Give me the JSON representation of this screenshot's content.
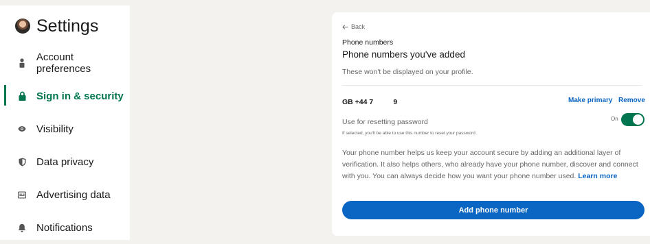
{
  "sidebar": {
    "title": "Settings",
    "items": [
      {
        "label": "Account preferences",
        "icon": "person-icon",
        "active": false
      },
      {
        "label": "Sign in & security",
        "icon": "lock-icon",
        "active": true
      },
      {
        "label": "Visibility",
        "icon": "eye-icon",
        "active": false
      },
      {
        "label": "Data privacy",
        "icon": "shield-icon",
        "active": false
      },
      {
        "label": "Advertising data",
        "icon": "ad-card-icon",
        "active": false
      },
      {
        "label": "Notifications",
        "icon": "bell-icon",
        "active": false
      }
    ]
  },
  "panel": {
    "back_label": "Back",
    "section_label": "Phone numbers",
    "heading": "Phone numbers you've added",
    "subtext": "These won't be displayed on your profile.",
    "phone_display": "GB +44 7          9",
    "make_primary_label": "Make primary",
    "remove_label": "Remove",
    "reset_label": "Use for resetting password",
    "reset_help": "If selected, you'll be able to use this number to reset your password",
    "toggle_state": "On",
    "info_text": "Your phone number helps us keep your account secure by adding an additional layer of verification. It also helps others, who already have your phone number, discover and connect with you. You can always decide how you want your phone number used. ",
    "learn_more_label": "Learn more",
    "add_button_label": "Add phone number"
  },
  "colors": {
    "accent_green": "#01754f",
    "link_blue": "#0a66c2",
    "background": "#f4f2ee"
  }
}
